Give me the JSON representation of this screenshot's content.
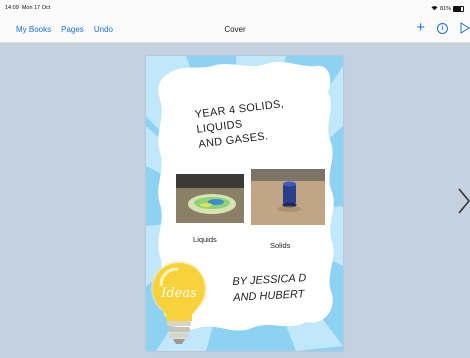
{
  "status_bar": {
    "time": "14:09",
    "date": "Mon 17 Oct",
    "battery": "81%"
  },
  "toolbar": {
    "my_books": "My Books",
    "pages": "Pages",
    "undo": "Undo",
    "title": "Cover",
    "info_glyph": "i"
  },
  "cover": {
    "title_line1": "YEAR 4 SOLIDS, LIQUIDS",
    "title_line2": "AND GASES.",
    "caption_liquids": "Liquids",
    "caption_solids": "Solids",
    "author_line1": "BY JESSICA D",
    "author_line2": "AND HUBERT",
    "bulb_text": "Ideas"
  },
  "icons": {
    "add": "plus-icon",
    "info": "info-icon",
    "play": "play-icon",
    "next": "chevron-right-icon",
    "bulb": "lightbulb-icon"
  },
  "colors": {
    "accent": "#1a73e8",
    "canvas": "#c4d2e0",
    "cover_blue": "#8ed2f3",
    "bulb": "#f7d23a"
  }
}
